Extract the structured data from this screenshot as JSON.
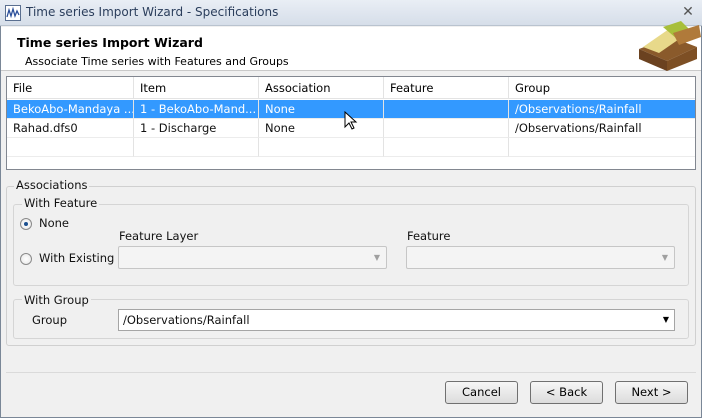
{
  "window": {
    "title": "Time series Import Wizard - Specifications",
    "close_glyph": "✕"
  },
  "header": {
    "title": "Time series Import Wizard",
    "subtitle": "Associate Time series with Features and Groups"
  },
  "grid": {
    "columns": [
      "File",
      "Item",
      "Association",
      "Feature",
      "Group"
    ],
    "rows": [
      {
        "file": "BekoAbo-Mandaya ...",
        "item": "1 - BekoAbo-Mand...",
        "association": "None",
        "feature": "",
        "group": "/Observations/Rainfall",
        "selected": true
      },
      {
        "file": "Rahad.dfs0",
        "item": "1 - Discharge",
        "association": "None",
        "feature": "",
        "group": "/Observations/Rainfall",
        "selected": false
      }
    ]
  },
  "associations": {
    "label": "Associations",
    "with_feature": {
      "label": "With Feature",
      "option_none": "None",
      "option_existing": "With Existing",
      "selected": "None",
      "feature_layer_label": "Feature Layer",
      "feature_layer_value": "",
      "feature_label": "Feature",
      "feature_value": ""
    },
    "with_group": {
      "label": "With Group",
      "group_label": "Group",
      "group_value": "/Observations/Rainfall"
    }
  },
  "buttons": {
    "cancel": "Cancel",
    "back": "< Back",
    "next": "Next >"
  },
  "colors": {
    "selection": "#3399ff",
    "title_text": "#2b3e5c"
  }
}
